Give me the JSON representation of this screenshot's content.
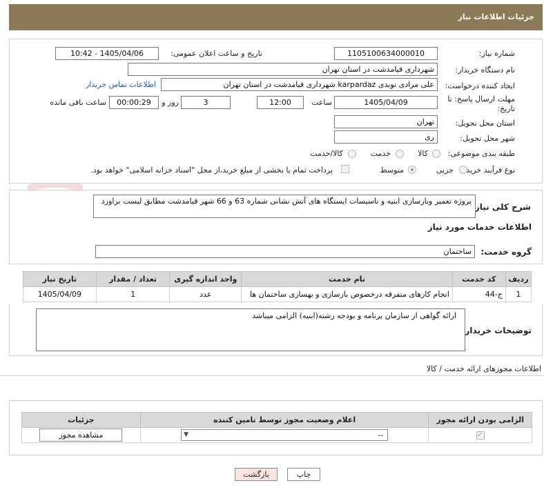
{
  "header": {
    "title": "جزئیات اطلاعات نیاز"
  },
  "info": {
    "need_number_label": "شماره نیاز:",
    "need_number": "1105100634000010",
    "announce_label": "تاریخ و ساعت اعلان عمومی:",
    "announce_value": "1405/04/06 - 10:42",
    "buyer_org_label": "نام دستگاه خریدار:",
    "buyer_org": "شهرداری قیامدشت در استان تهران",
    "creator_label": "ایجاد کننده درخواست:",
    "creator": "علی مرادی نوبدی karpardaz شهرداری قیامدشت در استان تهران",
    "buyer_contact_link": "اطلاعات تماس خریدار",
    "deadline_label_1": "مهلت ارسال پاسخ: تا",
    "deadline_label_2": "تاریخ:",
    "deadline_date": "1405/04/09",
    "time_label": "ساعت",
    "deadline_time": "12:00",
    "days_value": "3",
    "days_label": "روز و",
    "remaining_time": "00:00:29",
    "remaining_label": "ساعت باقی مانده",
    "province_label": "استان محل تحویل:",
    "province": "تهران",
    "city_label": "شهر محل تحویل:",
    "city": "ری",
    "category_label": "طبقه بندی موضوعی:",
    "category_options": [
      {
        "label": "کالا",
        "selected": false
      },
      {
        "label": "خدمت",
        "selected": false
      },
      {
        "label": "کالا/خدمت",
        "selected": false
      }
    ],
    "process_label": "نوع فرآیند خرید :",
    "process_options": [
      {
        "label": "جزیی",
        "selected": false
      },
      {
        "label": "متوسط",
        "selected": true
      }
    ],
    "treasury_note": "پرداخت تمام یا بخشی از مبلغ خرید،از محل \"اسناد خزانه اسلامی\" خواهد بود."
  },
  "description": {
    "label": "شرح کلی نیاز:",
    "text": "پروژه تعمیر وبازسازی ابنیه و تاسیسات ایستگاه های آتش نشانی شماره 63 و 66 شهر قیامدشت مطابق لیست براورد"
  },
  "services": {
    "section_title": "اطلاعات خدمات مورد نیاز",
    "group_label": "گروه خدمت:",
    "group_value": "ساختمان",
    "columns": [
      "ردیف",
      "کد خدمت",
      "نام خدمت",
      "واحد اندازه گیری",
      "تعداد / مقدار",
      "تاریخ نیاز"
    ],
    "rows": [
      [
        "1",
        "ج-44",
        "انجام کارهای متفرقه درخصوص بازسازی و بهسازی ساختمان ها",
        "عدد",
        "1",
        "1405/04/09"
      ]
    ]
  },
  "buyer_notes": {
    "label": "توضیحات خریدار:",
    "text": "ارائه گواهی از سازمان برنامه و بودجه رشته(ابنیه) الزامی میباشد"
  },
  "permits": {
    "section_title": "اطلاعات مجوزهای ارائه خدمت / کالا",
    "columns": [
      "الزامی بودن ارائه مجوز",
      "اعلام وضعیت مجوز توسط تامین کننده",
      "جزئیات"
    ],
    "select_value": "--",
    "view_button": "مشاهده مجوز"
  },
  "footer": {
    "print_button": "چاپ",
    "back_button": "بازگشت"
  },
  "watermark_text": "AriaTender.neT",
  "colors": {
    "header_bg": "#8b7a55",
    "link": "#1a5fb4",
    "back_button_bg": "#fbe3e3"
  }
}
